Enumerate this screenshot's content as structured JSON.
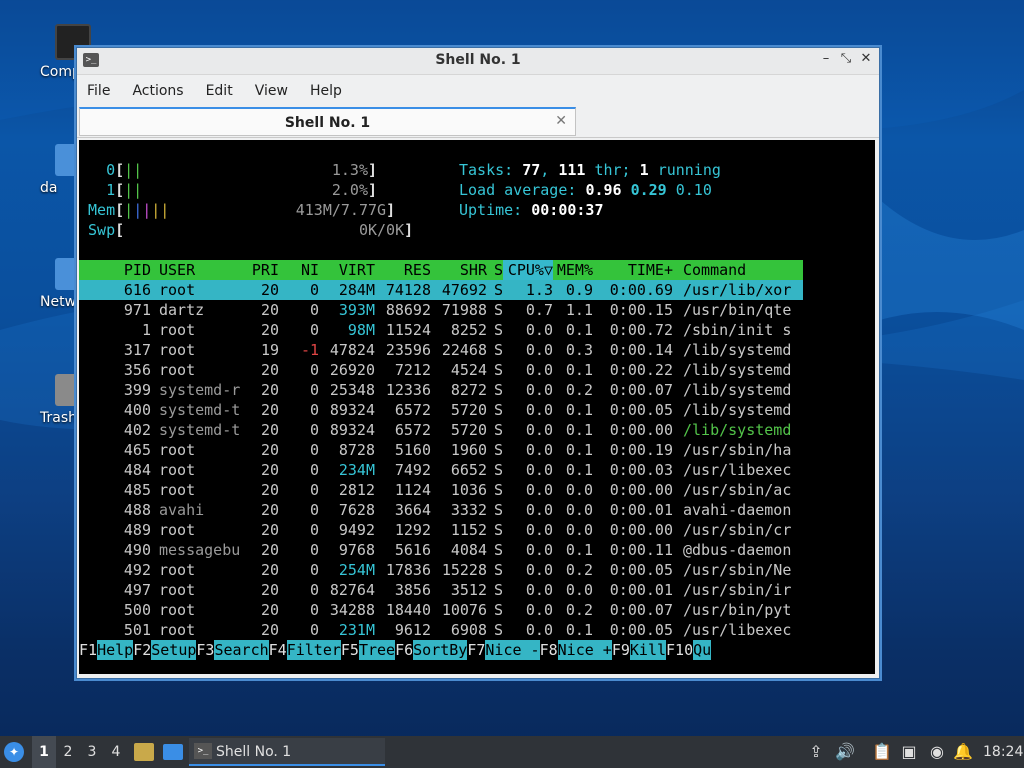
{
  "desktop": {
    "icons": [
      {
        "label": "Comp"
      },
      {
        "label": "da"
      },
      {
        "label": "Netw"
      },
      {
        "label": "Trash ("
      }
    ]
  },
  "window": {
    "title": "Shell No. 1",
    "menu": [
      "File",
      "Actions",
      "Edit",
      "View",
      "Help"
    ],
    "tab_label": "Shell No. 1",
    "controls": {
      "minimize": "–",
      "maximize": "⤡",
      "close": "✕",
      "tab_close": "✕"
    }
  },
  "htop": {
    "cpu0": {
      "label": "0",
      "bar": "||",
      "value": "1.3%"
    },
    "cpu1": {
      "label": "1",
      "bar": "||",
      "value": "2.0%"
    },
    "mem": {
      "label": "Mem",
      "bar": "|||||",
      "value": "413M/7.77G"
    },
    "swp": {
      "label": "Swp",
      "bar": "",
      "value": "0K/0K"
    },
    "tasks": {
      "label": "Tasks:",
      "count": "77",
      "threads": "111",
      "thr_label": "thr;",
      "running": "1",
      "running_label": "running"
    },
    "load": {
      "label": "Load average:",
      "l1": "0.96",
      "l5": "0.29",
      "l15": "0.10"
    },
    "uptime": {
      "label": "Uptime:",
      "value": "00:00:37"
    },
    "columns": [
      "PID",
      "USER",
      "PRI",
      "NI",
      "VIRT",
      "RES",
      "SHR",
      "S",
      "CPU%▽",
      "MEM%",
      "TIME+",
      "Command"
    ],
    "processes": [
      {
        "pid": "616",
        "user": "root",
        "pri": "20",
        "ni": "0",
        "virt": "284M",
        "res": "74128",
        "shr": "47692",
        "s": "S",
        "cpu": "1.3",
        "mem": "0.9",
        "time": "0:00.69",
        "cmd": "/usr/lib/xor",
        "selected": true
      },
      {
        "pid": "971",
        "user": "dartz",
        "pri": "20",
        "ni": "0",
        "virt": "393M",
        "res": "88692",
        "shr": "71988",
        "s": "S",
        "cpu": "0.7",
        "mem": "1.1",
        "time": "0:00.15",
        "cmd": "/usr/bin/qte"
      },
      {
        "pid": "1",
        "user": "root",
        "pri": "20",
        "ni": "0",
        "virt": "98M",
        "res": "11524",
        "shr": "8252",
        "s": "S",
        "cpu": "0.0",
        "mem": "0.1",
        "time": "0:00.72",
        "cmd": "/sbin/init s"
      },
      {
        "pid": "317",
        "user": "root",
        "pri": "19",
        "ni": "-1",
        "virt": "47824",
        "res": "23596",
        "shr": "22468",
        "s": "S",
        "cpu": "0.0",
        "mem": "0.3",
        "time": "0:00.14",
        "cmd": "/lib/systemd"
      },
      {
        "pid": "356",
        "user": "root",
        "pri": "20",
        "ni": "0",
        "virt": "26920",
        "res": "7212",
        "shr": "4524",
        "s": "S",
        "cpu": "0.0",
        "mem": "0.1",
        "time": "0:00.22",
        "cmd": "/lib/systemd"
      },
      {
        "pid": "399",
        "user": "systemd-r",
        "pri": "20",
        "ni": "0",
        "virt": "25348",
        "res": "12336",
        "shr": "8272",
        "s": "S",
        "cpu": "0.0",
        "mem": "0.2",
        "time": "0:00.07",
        "cmd": "/lib/systemd"
      },
      {
        "pid": "400",
        "user": "systemd-t",
        "pri": "20",
        "ni": "0",
        "virt": "89324",
        "res": "6572",
        "shr": "5720",
        "s": "S",
        "cpu": "0.0",
        "mem": "0.1",
        "time": "0:00.05",
        "cmd": "/lib/systemd"
      },
      {
        "pid": "402",
        "user": "systemd-t",
        "pri": "20",
        "ni": "0",
        "virt": "89324",
        "res": "6572",
        "shr": "5720",
        "s": "S",
        "cpu": "0.0",
        "mem": "0.1",
        "time": "0:00.00",
        "cmd": "/lib/systemd",
        "thread": true
      },
      {
        "pid": "465",
        "user": "root",
        "pri": "20",
        "ni": "0",
        "virt": "8728",
        "res": "5160",
        "shr": "1960",
        "s": "S",
        "cpu": "0.0",
        "mem": "0.1",
        "time": "0:00.19",
        "cmd": "/usr/sbin/ha"
      },
      {
        "pid": "484",
        "user": "root",
        "pri": "20",
        "ni": "0",
        "virt": "234M",
        "res": "7492",
        "shr": "6652",
        "s": "S",
        "cpu": "0.0",
        "mem": "0.1",
        "time": "0:00.03",
        "cmd": "/usr/libexec"
      },
      {
        "pid": "485",
        "user": "root",
        "pri": "20",
        "ni": "0",
        "virt": "2812",
        "res": "1124",
        "shr": "1036",
        "s": "S",
        "cpu": "0.0",
        "mem": "0.0",
        "time": "0:00.00",
        "cmd": "/usr/sbin/ac"
      },
      {
        "pid": "488",
        "user": "avahi",
        "pri": "20",
        "ni": "0",
        "virt": "7628",
        "res": "3664",
        "shr": "3332",
        "s": "S",
        "cpu": "0.0",
        "mem": "0.0",
        "time": "0:00.01",
        "cmd": "avahi-daemon"
      },
      {
        "pid": "489",
        "user": "root",
        "pri": "20",
        "ni": "0",
        "virt": "9492",
        "res": "1292",
        "shr": "1152",
        "s": "S",
        "cpu": "0.0",
        "mem": "0.0",
        "time": "0:00.00",
        "cmd": "/usr/sbin/cr"
      },
      {
        "pid": "490",
        "user": "messagebu",
        "pri": "20",
        "ni": "0",
        "virt": "9768",
        "res": "5616",
        "shr": "4084",
        "s": "S",
        "cpu": "0.0",
        "mem": "0.1",
        "time": "0:00.11",
        "cmd": "@dbus-daemon"
      },
      {
        "pid": "492",
        "user": "root",
        "pri": "20",
        "ni": "0",
        "virt": "254M",
        "res": "17836",
        "shr": "15228",
        "s": "S",
        "cpu": "0.0",
        "mem": "0.2",
        "time": "0:00.05",
        "cmd": "/usr/sbin/Ne"
      },
      {
        "pid": "497",
        "user": "root",
        "pri": "20",
        "ni": "0",
        "virt": "82764",
        "res": "3856",
        "shr": "3512",
        "s": "S",
        "cpu": "0.0",
        "mem": "0.0",
        "time": "0:00.01",
        "cmd": "/usr/sbin/ir"
      },
      {
        "pid": "500",
        "user": "root",
        "pri": "20",
        "ni": "0",
        "virt": "34288",
        "res": "18440",
        "shr": "10076",
        "s": "S",
        "cpu": "0.0",
        "mem": "0.2",
        "time": "0:00.07",
        "cmd": "/usr/bin/pyt"
      },
      {
        "pid": "501",
        "user": "root",
        "pri": "20",
        "ni": "0",
        "virt": "231M",
        "res": "9612",
        "shr": "6908",
        "s": "S",
        "cpu": "0.0",
        "mem": "0.1",
        "time": "0:00.05",
        "cmd": "/usr/libexec"
      }
    ],
    "fkeys": [
      {
        "key": "F1",
        "label": "Help  "
      },
      {
        "key": "F2",
        "label": "Setup "
      },
      {
        "key": "F3",
        "label": "Search"
      },
      {
        "key": "F4",
        "label": "Filter"
      },
      {
        "key": "F5",
        "label": "Tree  "
      },
      {
        "key": "F6",
        "label": "SortBy"
      },
      {
        "key": "F7",
        "label": "Nice -"
      },
      {
        "key": "F8",
        "label": "Nice +"
      },
      {
        "key": "F9",
        "label": "Kill  "
      },
      {
        "key": "F10",
        "label": "Qu"
      }
    ]
  },
  "taskbar": {
    "workspaces": [
      "1",
      "2",
      "3",
      "4"
    ],
    "active_workspace": "1",
    "task_label": "Shell No. 1",
    "clock": "18:24"
  },
  "colors": {
    "accent": "#3a8ee6",
    "htop_header": "#34c33b",
    "htop_select": "#35b5c5"
  }
}
